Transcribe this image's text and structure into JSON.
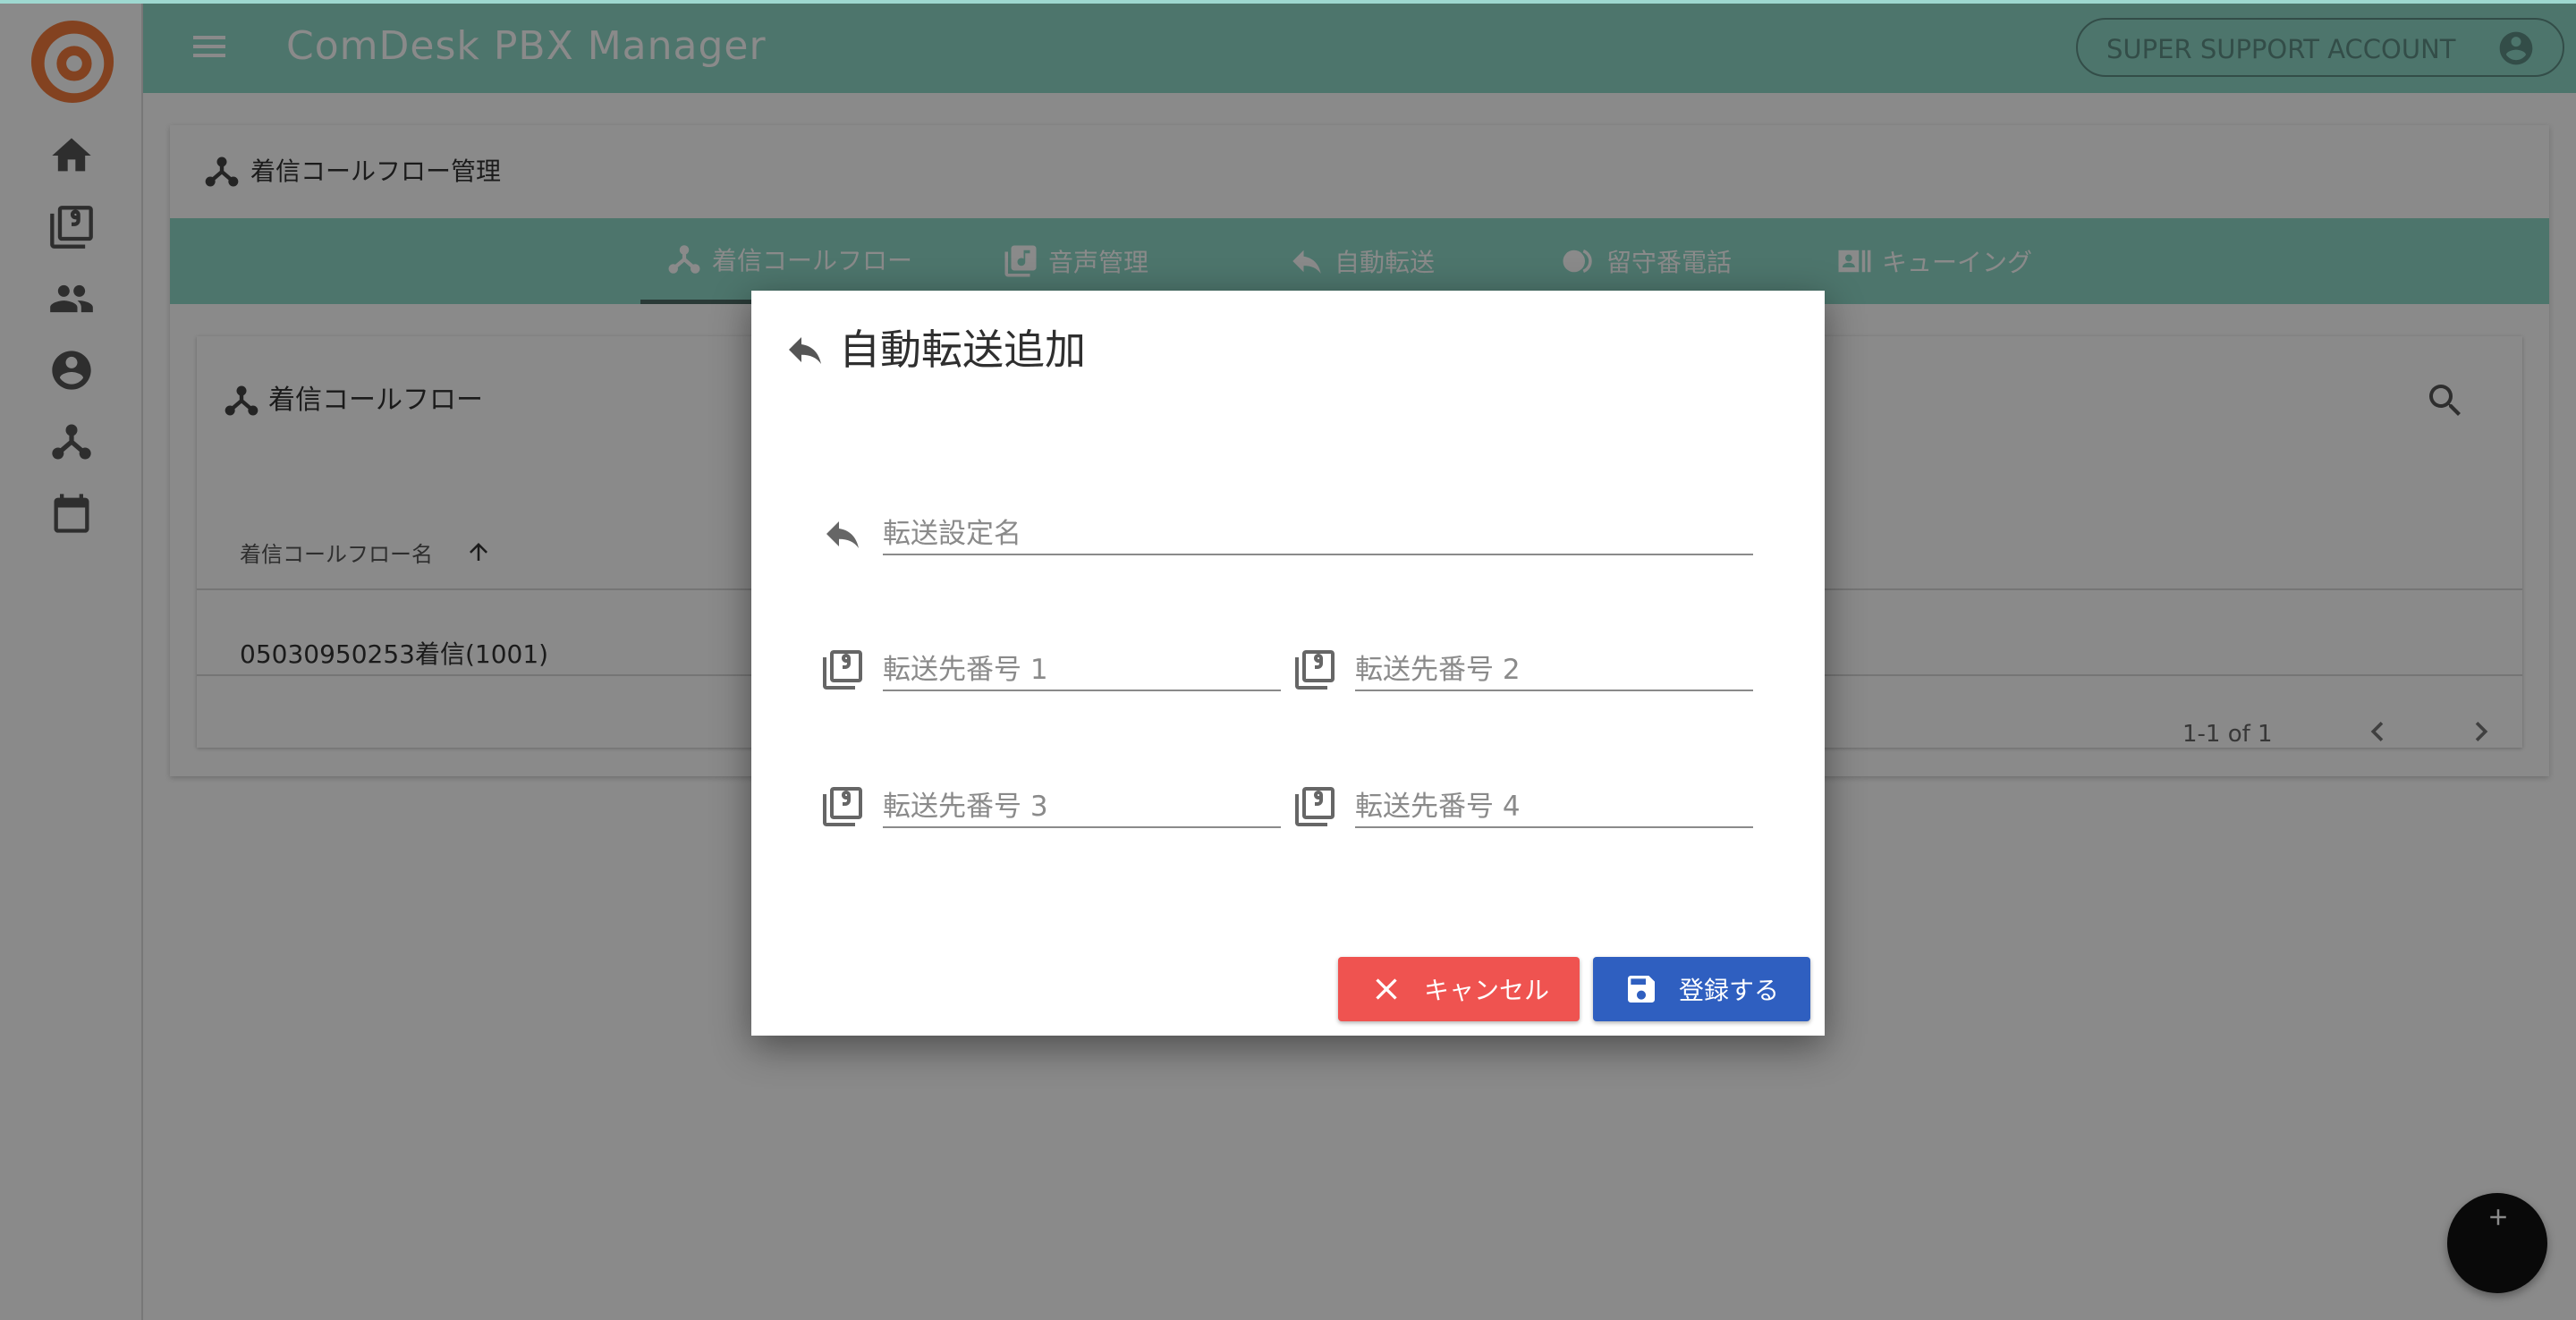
{
  "app": {
    "title": "ComDesk PBX Manager",
    "account_label": "SUPER SUPPORT ACCOUNT"
  },
  "colors": {
    "teal": "#8fd8c8",
    "cancel_red": "#ef5350",
    "save_blue": "#2f5fc0",
    "logo_orange": "#f27b3c"
  },
  "side_nav": {
    "items": [
      {
        "icon": "home-icon"
      },
      {
        "icon": "dialpad-box-icon"
      },
      {
        "icon": "people-icon"
      },
      {
        "icon": "account-circle-icon"
      },
      {
        "icon": "call-flow-icon"
      },
      {
        "icon": "calendar-icon"
      }
    ]
  },
  "page": {
    "title": "着信コールフロー管理",
    "tabs": [
      {
        "label": "着信コールフロー",
        "icon": "call-flow-icon",
        "active": true
      },
      {
        "label": "音声管理",
        "icon": "music-library-icon",
        "active": false
      },
      {
        "label": "自動転送",
        "icon": "reply-icon",
        "active": false
      },
      {
        "label": "留守番電話",
        "icon": "voicemail-icon",
        "active": false
      },
      {
        "label": "キューイング",
        "icon": "queue-icon",
        "active": false
      }
    ]
  },
  "flow_card": {
    "title": "着信コールフロー",
    "column_header": "着信コールフロー名",
    "rows": [
      {
        "name": "05030950253着信(1001)"
      }
    ],
    "pagination": "1-1 of 1"
  },
  "dialog": {
    "title": "自動転送追加",
    "fields": {
      "name_placeholder": "転送設定名",
      "number1_placeholder": "転送先番号 1",
      "number2_placeholder": "転送先番号 2",
      "number3_placeholder": "転送先番号 3",
      "number4_placeholder": "転送先番号 4"
    },
    "cancel_label": "キャンセル",
    "save_label": "登録する"
  }
}
